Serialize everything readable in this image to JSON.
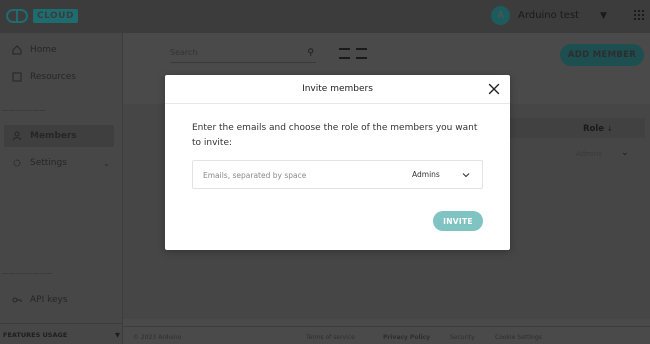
{
  "app": {
    "logo_text": "CLOUD",
    "user_initial": "A",
    "user_name": "Arduino test"
  },
  "sidebar": {
    "items": [
      {
        "label": "Home",
        "icon": "home-icon"
      },
      {
        "label": "Resources",
        "icon": "resources-icon"
      },
      {
        "label": "Members",
        "icon": "members-icon"
      },
      {
        "label": "Settings",
        "icon": "gear-icon"
      },
      {
        "label": "API keys",
        "icon": "key-icon"
      }
    ],
    "features_label": "FEATURES USAGE"
  },
  "main": {
    "search_placeholder": "Search",
    "add_member_label": "ADD MEMBER",
    "role_column": "Role",
    "row_role": "Admins"
  },
  "footer": {
    "copyright": "© 2023 Arduino",
    "links": [
      "Terms of service",
      "Privacy Policy",
      "Security",
      "Cookie Settings"
    ]
  },
  "modal": {
    "title": "Invite members",
    "description": "Enter the emails and choose the role of the members you want to invite:",
    "email_placeholder": "Emails, separated by space",
    "role_selected": "Admins",
    "invite_label": "INVITE"
  },
  "colors": {
    "accent": "#7fc4c2",
    "overlay": "#4a4a4a",
    "brand": "#1d6d70"
  }
}
